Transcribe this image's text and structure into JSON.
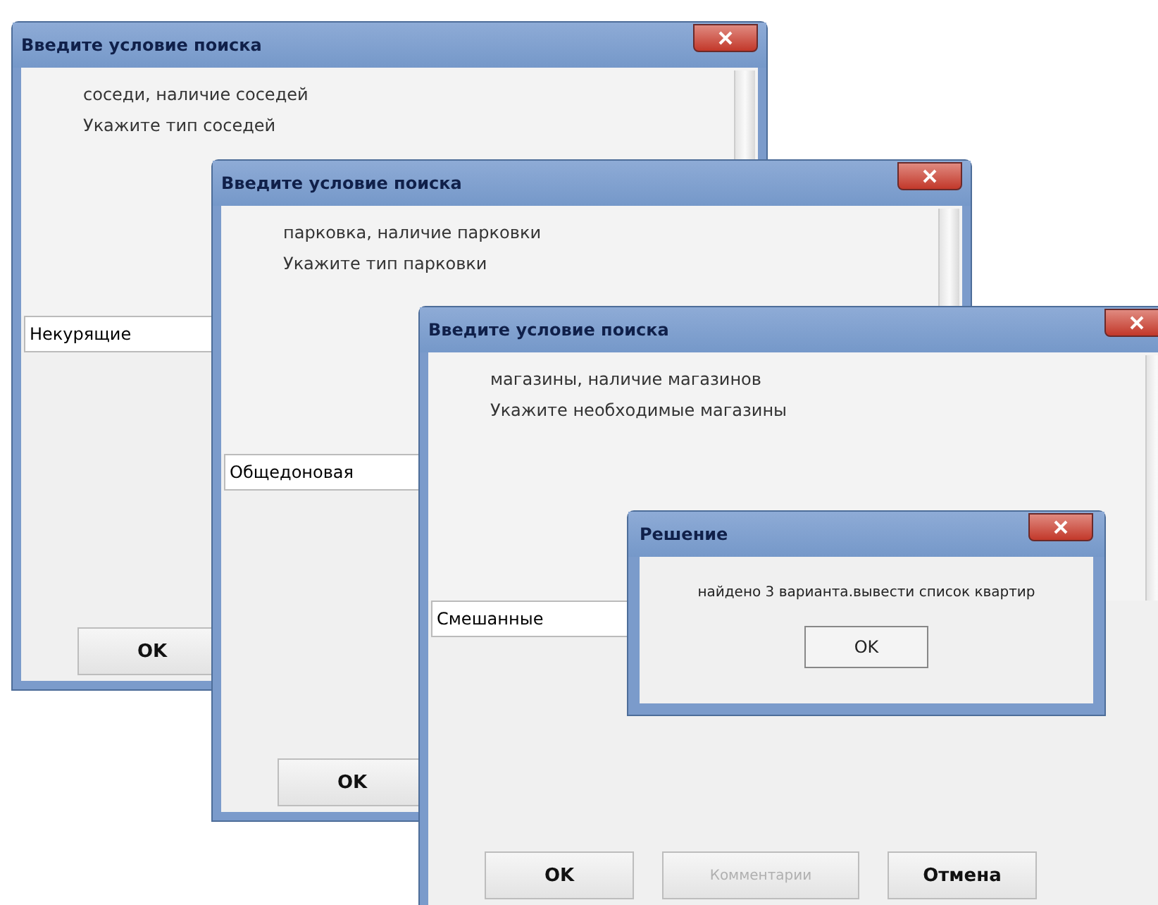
{
  "windows": [
    {
      "title": "Введите условие поиска",
      "lines": [
        "соседи, наличие соседей",
        "Укажите тип соседей"
      ],
      "input": {
        "value": "Некурящие"
      },
      "buttons": [
        {
          "label": "OK",
          "disabled": false
        }
      ]
    },
    {
      "title": "Введите условие поиска",
      "lines": [
        "парковка, наличие парковки",
        "Укажите тип парковки"
      ],
      "input": {
        "value": "Общедоновая"
      },
      "buttons": [
        {
          "label": "OK",
          "disabled": false
        }
      ]
    },
    {
      "title": "Введите условие поиска",
      "lines": [
        "магазины, наличие магазинов",
        "Укажите необходимые магазины"
      ],
      "input": {
        "value": "Смешанные"
      },
      "buttons": [
        {
          "label": "OK",
          "disabled": false
        },
        {
          "label": "Комментарии",
          "disabled": true
        },
        {
          "label": "Отмена",
          "disabled": false
        }
      ]
    }
  ],
  "message_box": {
    "title": "Решение",
    "message": "найдено 3 варианта.вывести список квартир",
    "button": "OK"
  }
}
